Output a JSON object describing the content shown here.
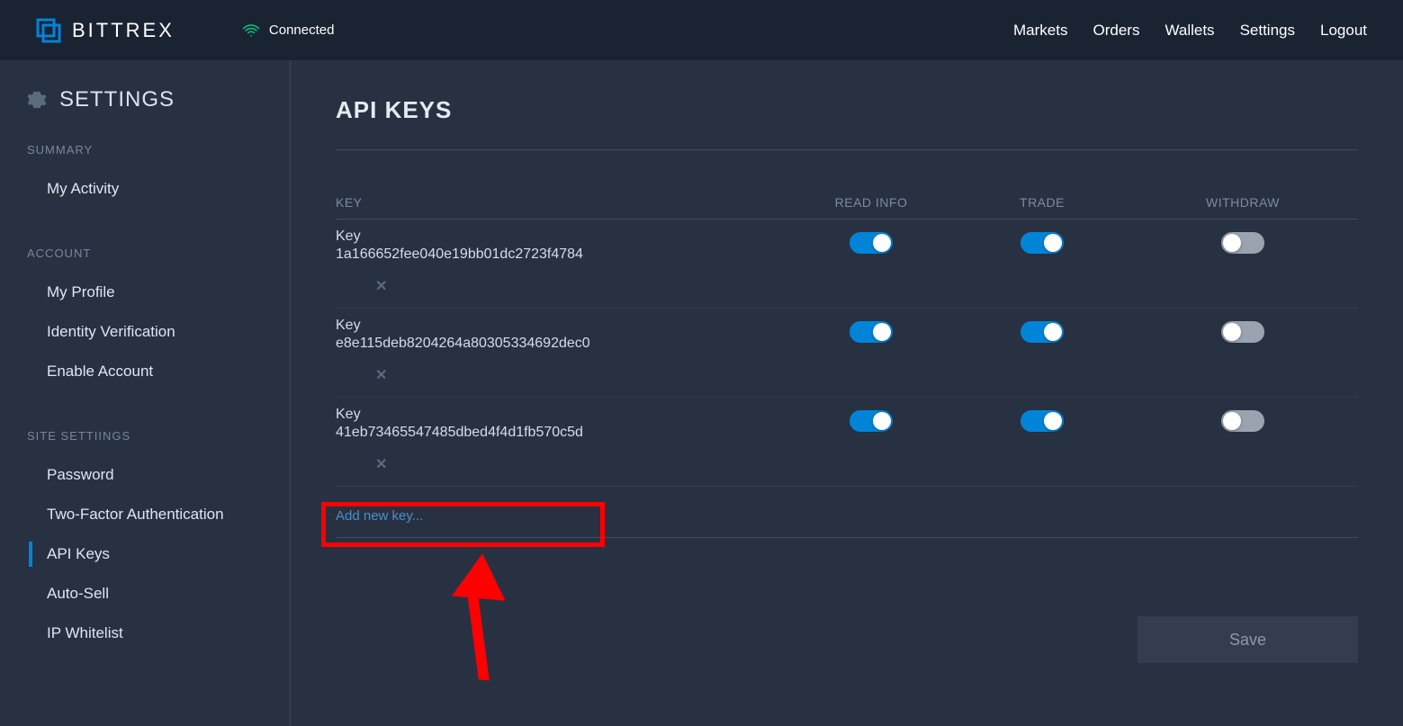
{
  "header": {
    "brand": "BITTREX",
    "connection_status": "Connected",
    "nav": [
      "Markets",
      "Orders",
      "Wallets",
      "Settings",
      "Logout"
    ]
  },
  "sidebar": {
    "title": "SETTINGS",
    "sections": [
      {
        "label": "SUMMARY",
        "items": [
          "My Activity"
        ]
      },
      {
        "label": "ACCOUNT",
        "items": [
          "My Profile",
          "Identity Verification",
          "Enable Account"
        ]
      },
      {
        "label": "SITE SETTIINGS",
        "items": [
          "Password",
          "Two-Factor Authentication",
          "API Keys",
          "Auto-Sell",
          "IP Whitelist"
        ]
      }
    ],
    "active": "API Keys"
  },
  "page": {
    "title": "API KEYS",
    "columns": {
      "key": "KEY",
      "read": "READ INFO",
      "trade": "TRADE",
      "withdraw": "WITHDRAW"
    },
    "key_label": "Key",
    "rows": [
      {
        "value": "1a166652fee040e19bb01dc2723f4784",
        "read": true,
        "trade": true,
        "withdraw": false
      },
      {
        "value": "e8e115deb8204264a80305334692dec0",
        "read": true,
        "trade": true,
        "withdraw": false
      },
      {
        "value": "41eb73465547485dbed4f4d1fb570c5d",
        "read": true,
        "trade": true,
        "withdraw": false
      }
    ],
    "add_new_label": "Add new key...",
    "save_label": "Save"
  }
}
